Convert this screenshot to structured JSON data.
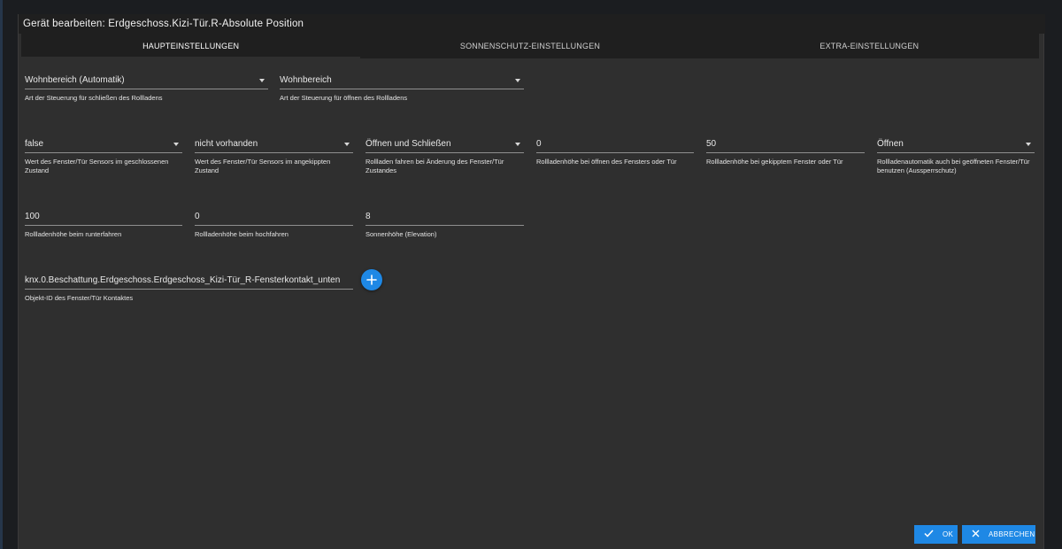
{
  "dialog": {
    "title": "Gerät bearbeiten: Erdgeschoss.Kizi-Tür.R-Absolute Position"
  },
  "tabs": [
    {
      "label": "HAUPTEINSTELLUNGEN",
      "active": true
    },
    {
      "label": "SONNENSCHUTZ-EINSTELLUNGEN",
      "active": false
    },
    {
      "label": "EXTRA-EINSTELLUNGEN",
      "active": false
    }
  ],
  "fields": {
    "close_control": {
      "value": "Wohnbereich (Automatik)",
      "label": "Art der Steuerung für schließen des Rollladens"
    },
    "open_control": {
      "value": "Wohnbereich",
      "label": "Art der Steuerung für öffnen des Rollladens"
    },
    "sensor_closed": {
      "value": "false",
      "label": "Wert des Fenster/Tür Sensors im geschlossenen Zustand"
    },
    "sensor_tilted": {
      "value": "nicht vorhanden",
      "label": "Wert des Fenster/Tür Sensors im angekippten Zustand"
    },
    "move_on_change": {
      "value": "Öffnen und Schließen",
      "label": "Rollladen fahren bei Änderung des Fenster/Tür Zustandes"
    },
    "height_window_open": {
      "value": "0",
      "label": "Rollladenhöhe bei öffnen des Fensters oder Tür"
    },
    "height_window_tilted": {
      "value": "50",
      "label": "Rollladenhöhe bei gekipptem Fenster oder Tür"
    },
    "lockout_protection": {
      "value": "Öffnen",
      "label": "Rollladenautomatik auch bei geöffneten Fenster/Tür benutzen (Aussperrschutz)"
    },
    "height_down": {
      "value": "100",
      "label": "Rollladenhöhe beim runterfahren"
    },
    "height_up": {
      "value": "0",
      "label": "Rollladenhöhe beim hochfahren"
    },
    "sun_elevation": {
      "value": "8",
      "label": "Sonnenhöhe (Elevation)"
    },
    "contact_object_id": {
      "value": "knx.0.Beschattung.Erdgeschoss.Erdgeschoss_Kizi-Tür_R-Fensterkontakt_unten",
      "label": "Objekt-ID des Fenster/Tür Kontaktes"
    }
  },
  "icons": {
    "add": "plus-icon",
    "ok": "check-icon",
    "cancel": "close-icon"
  },
  "buttons": {
    "ok_label": "OK",
    "cancel_label": "ABBRECHEN"
  },
  "colors": {
    "accent": "#1e88e5",
    "dialog_bg": "#2f2f2f",
    "header_bg": "#1f1f1f"
  }
}
